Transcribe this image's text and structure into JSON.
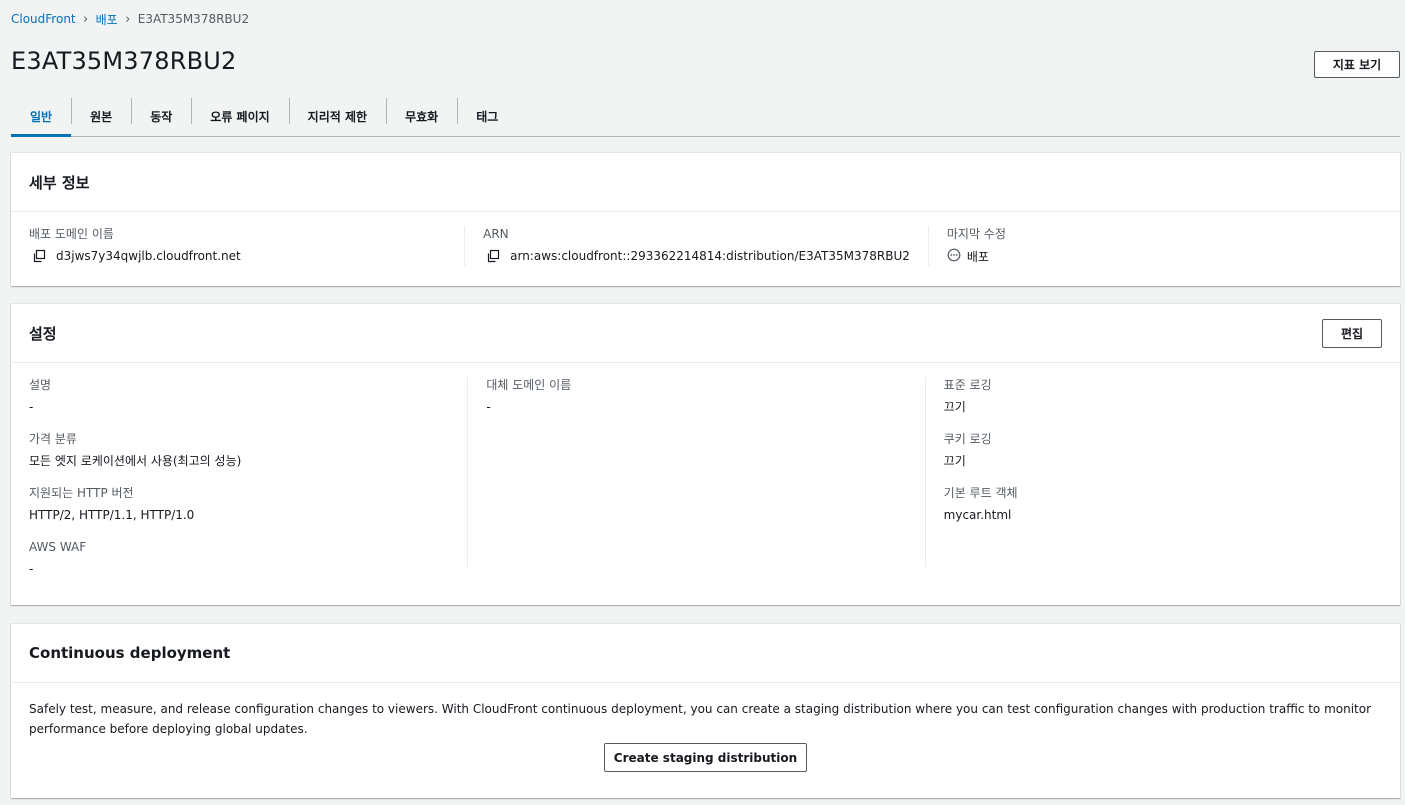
{
  "breadcrumb": {
    "items": [
      "CloudFront",
      "배포"
    ],
    "current": "E3AT35M378RBU2"
  },
  "page": {
    "title": "E3AT35M378RBU2",
    "metrics_button": "지표 보기"
  },
  "tabs": [
    {
      "label": "일반",
      "active": true
    },
    {
      "label": "원본"
    },
    {
      "label": "동작"
    },
    {
      "label": "오류 페이지"
    },
    {
      "label": "지리적 제한"
    },
    {
      "label": "무효화"
    },
    {
      "label": "태그"
    }
  ],
  "details": {
    "title": "세부 정보",
    "domain_label": "배포 도메인 이름",
    "domain_value": "d3jws7y34qwjlb.cloudfront.net",
    "arn_label": "ARN",
    "arn_value": "arn:aws:cloudfront::293362214814:distribution/E3AT35M378RBU2",
    "modified_label": "마지막 수정",
    "modified_value": "배포"
  },
  "settings": {
    "title": "설정",
    "edit_button": "편집",
    "description_label": "설명",
    "description_value": "-",
    "price_class_label": "가격 분류",
    "price_class_value": "모든 엣지 로케이션에서 사용(최고의 성능)",
    "http_label": "지원되는 HTTP 버전",
    "http_value": "HTTP/2, HTTP/1.1, HTTP/1.0",
    "waf_label": "AWS WAF",
    "waf_value": "-",
    "alt_domain_label": "대체 도메인 이름",
    "alt_domain_value": "-",
    "std_logging_label": "표준 로깅",
    "std_logging_value": "끄기",
    "cookie_logging_label": "쿠키 로깅",
    "cookie_logging_value": "끄기",
    "root_object_label": "기본 루트 객체",
    "root_object_value": "mycar.html"
  },
  "continuous": {
    "title": "Continuous deployment",
    "description": "Safely test, measure, and release configuration changes to viewers. With CloudFront continuous deployment, you can create a staging distribution where you can test configuration changes with production traffic to monitor performance before deploying global updates.",
    "button": "Create staging distribution"
  },
  "colors": {
    "link": "#0073bb",
    "border": "#545b64",
    "background": "#f2f3f3"
  }
}
